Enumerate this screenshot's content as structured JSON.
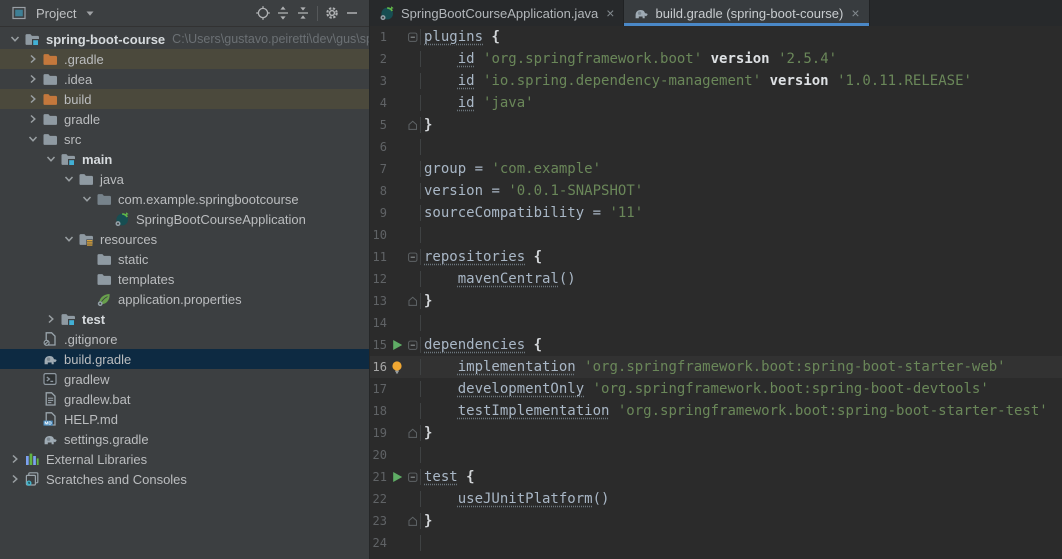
{
  "project": {
    "title": "Project",
    "toolbar": [
      {
        "icon": "locate",
        "name": "locate-icon"
      },
      {
        "icon": "expand-all",
        "name": "expand-all-icon"
      },
      {
        "icon": "collapse-all",
        "name": "collapse-all-icon"
      },
      {
        "icon": "sep",
        "name": "toolbar-separator"
      },
      {
        "icon": "gear",
        "name": "gear-icon"
      },
      {
        "icon": "minus",
        "name": "hide-panel-icon"
      }
    ],
    "tree": [
      {
        "indent": 0,
        "chevron": "down",
        "icon": "folder-src",
        "label": "spring-boot-course",
        "bold": true,
        "sublabel": "C:\\Users\\gustavo.peiretti\\dev\\gus\\spring"
      },
      {
        "indent": 1,
        "chevron": "right",
        "icon": "folder-orange",
        "label": ".gradle",
        "row": "excluded"
      },
      {
        "indent": 1,
        "chevron": "right",
        "icon": "folder-gray",
        "label": ".idea"
      },
      {
        "indent": 1,
        "chevron": "right",
        "icon": "folder-orange",
        "label": "build",
        "row": "excluded"
      },
      {
        "indent": 1,
        "chevron": "right",
        "icon": "folder-gray",
        "label": "gradle"
      },
      {
        "indent": 1,
        "chevron": "down",
        "icon": "folder-gray",
        "label": "src"
      },
      {
        "indent": 2,
        "chevron": "down",
        "icon": "folder-src",
        "label": "main",
        "bold": true
      },
      {
        "indent": 3,
        "chevron": "down",
        "icon": "folder-gray",
        "label": "java"
      },
      {
        "indent": 4,
        "chevron": "down",
        "icon": "folder-package",
        "label": "com.example.springbootcourse"
      },
      {
        "indent": 5,
        "chevron": null,
        "icon": "springboot",
        "label": "SpringBootCourseApplication"
      },
      {
        "indent": 3,
        "chevron": "down",
        "icon": "folder-res",
        "label": "resources"
      },
      {
        "indent": 4,
        "chevron": null,
        "icon": "folder-gray",
        "label": "static"
      },
      {
        "indent": 4,
        "chevron": null,
        "icon": "folder-gray",
        "label": "templates"
      },
      {
        "indent": 4,
        "chevron": null,
        "icon": "leaf",
        "label": "application.properties"
      },
      {
        "indent": 2,
        "chevron": "right",
        "icon": "folder-src",
        "label": "test",
        "bold": true
      },
      {
        "indent": 1,
        "chevron": null,
        "icon": "gitignore",
        "label": ".gitignore"
      },
      {
        "indent": 1,
        "chevron": null,
        "icon": "gradle",
        "label": "build.gradle",
        "row": "selected"
      },
      {
        "indent": 1,
        "chevron": null,
        "icon": "console",
        "label": "gradlew"
      },
      {
        "indent": 1,
        "chevron": null,
        "icon": "file-text",
        "label": "gradlew.bat"
      },
      {
        "indent": 1,
        "chevron": null,
        "icon": "markdown",
        "label": "HELP.md"
      },
      {
        "indent": 1,
        "chevron": null,
        "icon": "gradle",
        "label": "settings.gradle"
      },
      {
        "indent": 0,
        "chevron": "right",
        "icon": "libraries",
        "label": "External Libraries"
      },
      {
        "indent": 0,
        "chevron": "right",
        "icon": "scratches",
        "label": "Scratches and Consoles"
      }
    ]
  },
  "editor": {
    "tabs": [
      {
        "icon": "springboot",
        "label": "SpringBootCourseApplication.java",
        "close": "×",
        "active": false
      },
      {
        "icon": "gradle",
        "label": "build.gradle (spring-boot-course)",
        "close": "×",
        "active": true
      }
    ],
    "lines": [
      {
        "n": 1,
        "fold": "start",
        "tokens": [
          [
            "plugins",
            "idu"
          ],
          [
            " ",
            "p"
          ],
          [
            "{",
            "br"
          ]
        ]
      },
      {
        "n": 2,
        "tokens": [
          [
            "    ",
            "p"
          ],
          [
            "id",
            "idu"
          ],
          [
            " ",
            "p"
          ],
          [
            "'org.springframework.boot'",
            "str"
          ],
          [
            " ",
            "p"
          ],
          [
            "version",
            "kw"
          ],
          [
            " ",
            "p"
          ],
          [
            "'2.5.4'",
            "str"
          ]
        ]
      },
      {
        "n": 3,
        "tokens": [
          [
            "    ",
            "p"
          ],
          [
            "id",
            "idu"
          ],
          [
            " ",
            "p"
          ],
          [
            "'io.spring.dependency-management'",
            "str"
          ],
          [
            " ",
            "p"
          ],
          [
            "version",
            "kw"
          ],
          [
            " ",
            "p"
          ],
          [
            "'1.0.11.RELEASE'",
            "str"
          ]
        ]
      },
      {
        "n": 4,
        "tokens": [
          [
            "    ",
            "p"
          ],
          [
            "id",
            "idu"
          ],
          [
            " ",
            "p"
          ],
          [
            "'java'",
            "str"
          ]
        ]
      },
      {
        "n": 5,
        "fold": "end",
        "tokens": [
          [
            "}",
            "br"
          ]
        ]
      },
      {
        "n": 6,
        "tokens": []
      },
      {
        "n": 7,
        "tokens": [
          [
            "group",
            "id"
          ],
          [
            " = ",
            "p"
          ],
          [
            "'com.example'",
            "str"
          ]
        ]
      },
      {
        "n": 8,
        "tokens": [
          [
            "version",
            "id"
          ],
          [
            " = ",
            "p"
          ],
          [
            "'0.0.1-SNAPSHOT'",
            "str"
          ]
        ]
      },
      {
        "n": 9,
        "tokens": [
          [
            "sourceCompatibility",
            "id"
          ],
          [
            " = ",
            "p"
          ],
          [
            "'11'",
            "str"
          ]
        ]
      },
      {
        "n": 10,
        "tokens": []
      },
      {
        "n": 11,
        "fold": "start",
        "tokens": [
          [
            "repositories",
            "idu"
          ],
          [
            " ",
            "p"
          ],
          [
            "{",
            "br"
          ]
        ]
      },
      {
        "n": 12,
        "tokens": [
          [
            "    ",
            "p"
          ],
          [
            "mavenCentral",
            "idu"
          ],
          [
            "()",
            "p"
          ]
        ]
      },
      {
        "n": 13,
        "fold": "end",
        "tokens": [
          [
            "}",
            "br"
          ]
        ]
      },
      {
        "n": 14,
        "tokens": []
      },
      {
        "n": 15,
        "fold": "start",
        "run": true,
        "tokens": [
          [
            "dependencies",
            "idu"
          ],
          [
            " ",
            "p"
          ],
          [
            "{",
            "br"
          ]
        ]
      },
      {
        "n": 16,
        "caret": true,
        "bulb": true,
        "tokens": [
          [
            "    ",
            "p"
          ],
          [
            "implementation",
            "idu"
          ],
          [
            " ",
            "p"
          ],
          [
            "'org.springframework.boot:spring-boot-starter-web'",
            "str"
          ]
        ]
      },
      {
        "n": 17,
        "tokens": [
          [
            "    ",
            "p"
          ],
          [
            "developmentOnly",
            "idu"
          ],
          [
            " ",
            "p"
          ],
          [
            "'org.springframework.boot:spring-boot-devtools'",
            "str"
          ]
        ]
      },
      {
        "n": 18,
        "tokens": [
          [
            "    ",
            "p"
          ],
          [
            "testImplementation",
            "idu"
          ],
          [
            " ",
            "p"
          ],
          [
            "'org.springframework.boot:spring-boot-starter-test'",
            "str"
          ]
        ]
      },
      {
        "n": 19,
        "fold": "end",
        "tokens": [
          [
            "}",
            "br"
          ]
        ]
      },
      {
        "n": 20,
        "tokens": []
      },
      {
        "n": 21,
        "fold": "start",
        "run": true,
        "tokens": [
          [
            "test",
            "idu"
          ],
          [
            " ",
            "p"
          ],
          [
            "{",
            "br"
          ]
        ]
      },
      {
        "n": 22,
        "tokens": [
          [
            "    ",
            "p"
          ],
          [
            "useJUnitPlatform",
            "idu"
          ],
          [
            "()",
            "p"
          ]
        ]
      },
      {
        "n": 23,
        "fold": "end",
        "tokens": [
          [
            "}",
            "br"
          ]
        ]
      },
      {
        "n": 24,
        "tokens": []
      }
    ]
  },
  "colors": {
    "tab_accent": "#4a88c7",
    "string_green": "#6a8759",
    "selected_row": "#0d2a42",
    "excluded_row": "#4b493c",
    "editor_bg": "#2b2b2b",
    "panel_bg": "#3c3f41"
  }
}
